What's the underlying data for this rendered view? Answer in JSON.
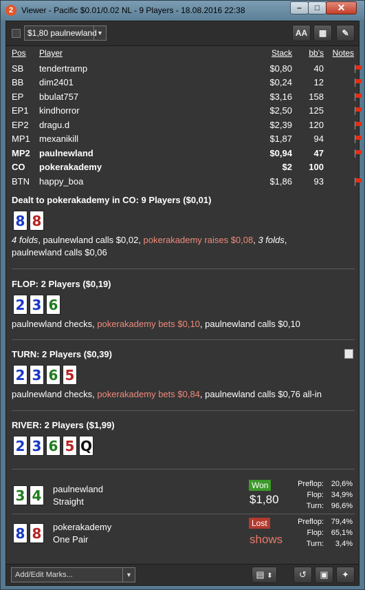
{
  "window": {
    "app_icon": "2",
    "title": "Viewer - Pacific $0.01/0.02 NL - 9 Players - 18.08.2016 22:38",
    "min_glyph": "–",
    "max_glyph": "□",
    "close_glyph": "✕"
  },
  "toolbar": {
    "selected_hand": "$1,80 paulnewland",
    "font_glyph": "AA",
    "grid_glyph": "▦",
    "edit_glyph": "✎"
  },
  "players": {
    "headers": {
      "pos": "Pos",
      "player": "Player",
      "stack": "Stack",
      "bbs": "bb's",
      "notes": "Notes"
    },
    "rows": [
      {
        "pos": "SB",
        "name": "tendertramp",
        "stack": "$0,80",
        "bbs": "40",
        "flag": true
      },
      {
        "pos": "BB",
        "name": "dim2401",
        "stack": "$0,24",
        "bbs": "12",
        "flag": true
      },
      {
        "pos": "EP",
        "name": "bbulat757",
        "stack": "$3,16",
        "bbs": "158",
        "flag": true
      },
      {
        "pos": "EP1",
        "name": "kindhorror",
        "stack": "$2,50",
        "bbs": "125",
        "flag": true
      },
      {
        "pos": "EP2",
        "name": "dragu.d",
        "stack": "$2,39",
        "bbs": "120",
        "flag": true
      },
      {
        "pos": "MP1",
        "name": "mexanikill",
        "stack": "$1,87",
        "bbs": "94",
        "flag": true
      },
      {
        "pos": "MP2",
        "name": "paulnewland",
        "stack": "$0,94",
        "bbs": "47",
        "flag": true
      },
      {
        "pos": "CO",
        "name": "pokerakademy",
        "stack": "$2",
        "bbs": "100",
        "flag": false
      },
      {
        "pos": "BTN",
        "name": "happy_boa",
        "stack": "$1,86",
        "bbs": "93",
        "flag": true
      }
    ]
  },
  "preflop": {
    "title": "Dealt to pokerakademy in CO: 9 Players ($0,01)",
    "cards": [
      "8",
      "8"
    ],
    "a1": "4 folds",
    "a2": ", paulnewland calls $0,02, ",
    "a3": "pokerakademy raises $0,08",
    "a4": ", ",
    "a5": "3 folds",
    "a6": ",",
    "a7": "paulnewland calls $0,06"
  },
  "flop": {
    "title": "FLOP: 2 Players ($0,19)",
    "cards": [
      "2",
      "3",
      "6"
    ],
    "a1": "paulnewland checks, ",
    "a2": "pokerakademy bets $0,10",
    "a3": ", paulnewland calls $0,10"
  },
  "turn": {
    "title": "TURN: 2 Players ($0,39)",
    "cards": [
      "2",
      "3",
      "6",
      "5"
    ],
    "a1": "paulnewland checks, ",
    "a2": "pokerakademy bets $0,84",
    "a3": ", paulnewland calls $0,76 all-in",
    "note_icon": "note-icon"
  },
  "river": {
    "title": "RIVER: 2 Players ($1,99)",
    "cards": [
      "2",
      "3",
      "6",
      "5",
      "Q"
    ]
  },
  "showdown": [
    {
      "cards": [
        "3",
        "4"
      ],
      "name": "paulnewland",
      "hand": "Straight",
      "result": "Won",
      "amount": "$1,80",
      "equity": {
        "preflop_label": "Preflop:",
        "preflop": "20,6%",
        "flop_label": "Flop:",
        "flop": "34,9%",
        "turn_label": "Turn:",
        "turn": "96,6%"
      }
    },
    {
      "cards": [
        "8",
        "8"
      ],
      "name": "pokerakademy",
      "hand": "One Pair",
      "result": "Lost",
      "amount": "shows",
      "equity": {
        "preflop_label": "Preflop:",
        "preflop": "79,4%",
        "flop_label": "Flop:",
        "flop": "65,1%",
        "turn_label": "Turn:",
        "turn": "3,4%"
      }
    }
  ],
  "footer": {
    "marks_placeholder": "Add/Edit Marks...",
    "clipboard_glyph": "▤",
    "spinner_glyph": "⬍",
    "replay_glyph": "↺",
    "save_glyph": "▣",
    "share_glyph": "✦"
  },
  "colors": {
    "accent_raise": "#f08a7a",
    "won": "#3c9a2a",
    "lost": "#b33a2f",
    "club": "#1e7d1e",
    "diamond": "#1838c8",
    "heart": "#b82424"
  }
}
